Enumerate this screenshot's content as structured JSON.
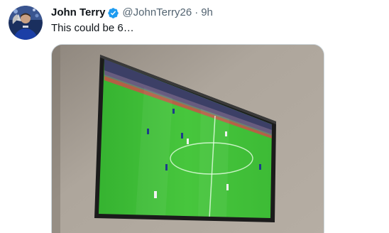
{
  "tweet": {
    "author": {
      "display_name": "John Terry",
      "handle": "@JohnTerry26",
      "avatar_icon": "avatar-player-photo",
      "verified_icon": "verified-badge-icon",
      "verified_color": "#1d9bf0"
    },
    "separator": "·",
    "timestamp": "9h",
    "text": "This could be 6…",
    "media": {
      "description_icon": "tv-photo-football-match",
      "pitch_color": "#3fbf3a",
      "wall_color": "#a39a90"
    }
  }
}
